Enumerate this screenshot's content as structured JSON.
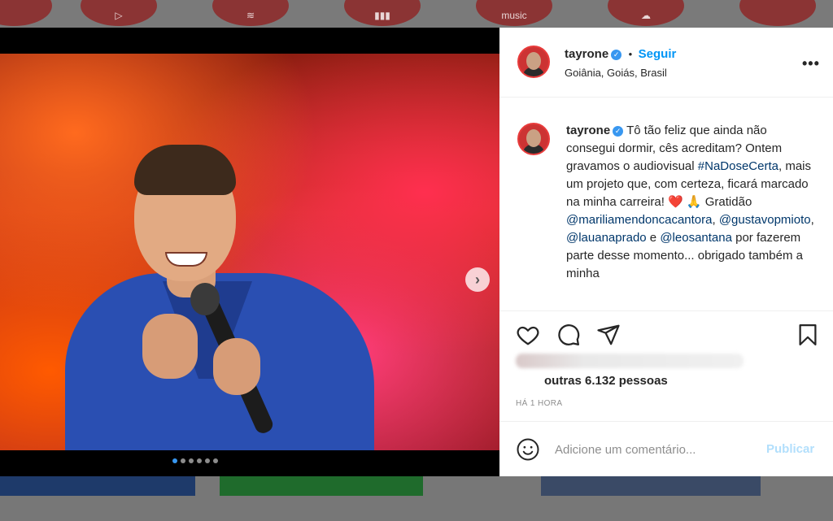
{
  "background": {
    "icons": [
      {
        "name": "youtube",
        "glyph": "▷"
      },
      {
        "name": "spotify",
        "glyph": "≋"
      },
      {
        "name": "deezer",
        "glyph": "▮▮▮"
      },
      {
        "name": "amazon-music",
        "glyph": "music"
      },
      {
        "name": "soundcloud",
        "glyph": "☁"
      }
    ]
  },
  "post": {
    "author": {
      "username": "tayrone",
      "verified": true,
      "location": "Goiânia, Goiás, Brasil"
    },
    "follow_label": "Seguir",
    "separator": "•",
    "more_label": "•••",
    "carousel": {
      "total": 6,
      "current": 1,
      "next_label": "›"
    },
    "caption": {
      "username": "tayrone",
      "line1": "Tô tão feliz que ainda não consegui dormir, cês acreditam? Ontem gravamos o audiovisual ",
      "hashtag": "#NaDoseCerta",
      "line2": ", mais um projeto que, com certeza, ficará marcado na minha carreira! ",
      "emojis": "❤️ 🙏",
      "gratitude": " Gratidão ",
      "mention1": "@mariliamendoncacantora",
      "comma1": ", ",
      "mention2": "@gustavopmioto",
      "comma2": ", ",
      "mention3": "@lauanaprado",
      "and": " e ",
      "mention4": "@leosantana",
      "line3": " por fazerem parte desse momento... obrigado também a minha"
    },
    "likes_text": "outras 6.132 pessoas",
    "time_text": "HÁ 1 HORA",
    "comment": {
      "placeholder": "Adicione um comentário...",
      "publish_label": "Publicar"
    }
  },
  "colors": {
    "accent": "#0095f6",
    "verified": "#3897f0",
    "mention": "#00376b",
    "publish_disabled": "#b2dffc"
  }
}
